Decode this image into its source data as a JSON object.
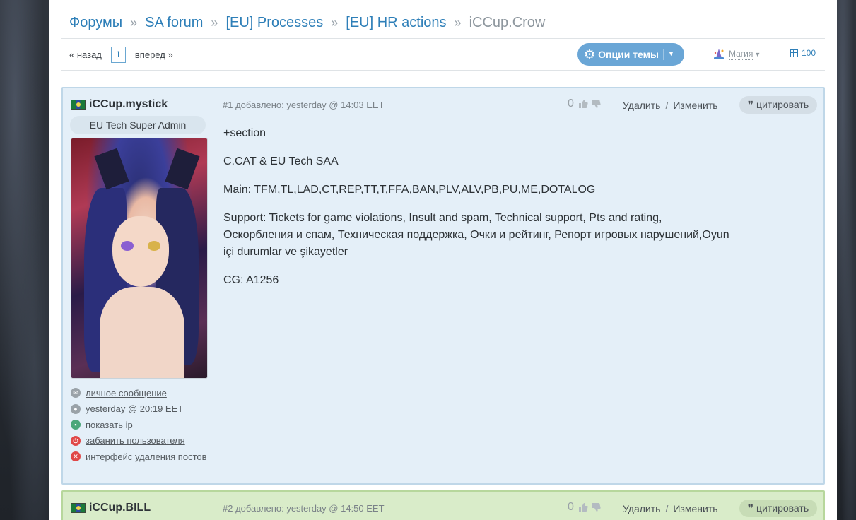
{
  "breadcrumb": {
    "items": [
      "Форумы",
      "SA forum",
      "[EU] Processes",
      "[EU] HR actions"
    ],
    "separator": "»",
    "current": "iCCup.Crow"
  },
  "pager": {
    "prev": "« назад",
    "page": "1",
    "next": "вперед »"
  },
  "toolbar": {
    "options_label": "Опции темы",
    "magic_label": "Магия",
    "count": "100"
  },
  "posts": [
    {
      "author": "iCCup.mystick",
      "role": "EU Tech Super Admin",
      "meta": "#1 добавлено: yesterday @ 14:03 EET",
      "rating": "0",
      "delete": "Удалить",
      "edit": "Изменить",
      "quote": "цитировать",
      "links": {
        "pm": "личное сообщение",
        "last_seen": "yesterday @ 20:19 EET",
        "show_ip": "показать ip",
        "ban": "забанить пользователя",
        "delete_ui": "интерфейс удаления постов"
      },
      "content": [
        "+section",
        "C.CAT & EU Tech SAA",
        "Main: TFM,TL,LAD,CT,REP,TT,T,FFA,BAN,PLV,ALV,PB,PU,ME,DOTALOG",
        "Support: Tickets for game violations, Insult and spam, Technical support, Pts and rating, Оскорбления и спам, Техническая поддержка, Очки и рейтинг, Репорт игровых нарушений,Oyun içi durumlar ve şikayetler",
        "CG: A1256"
      ]
    },
    {
      "author": "iCCup.BILL",
      "meta": "#2 добавлено: yesterday @ 14:50 EET",
      "rating": "0",
      "delete": "Удалить",
      "edit": "Изменить",
      "quote": "цитировать"
    }
  ],
  "colors": {
    "link": "#2e7fb8",
    "post_bg": "#e4eff8",
    "post2_bg": "#d9ecc9",
    "button": "#6aa6d6"
  }
}
